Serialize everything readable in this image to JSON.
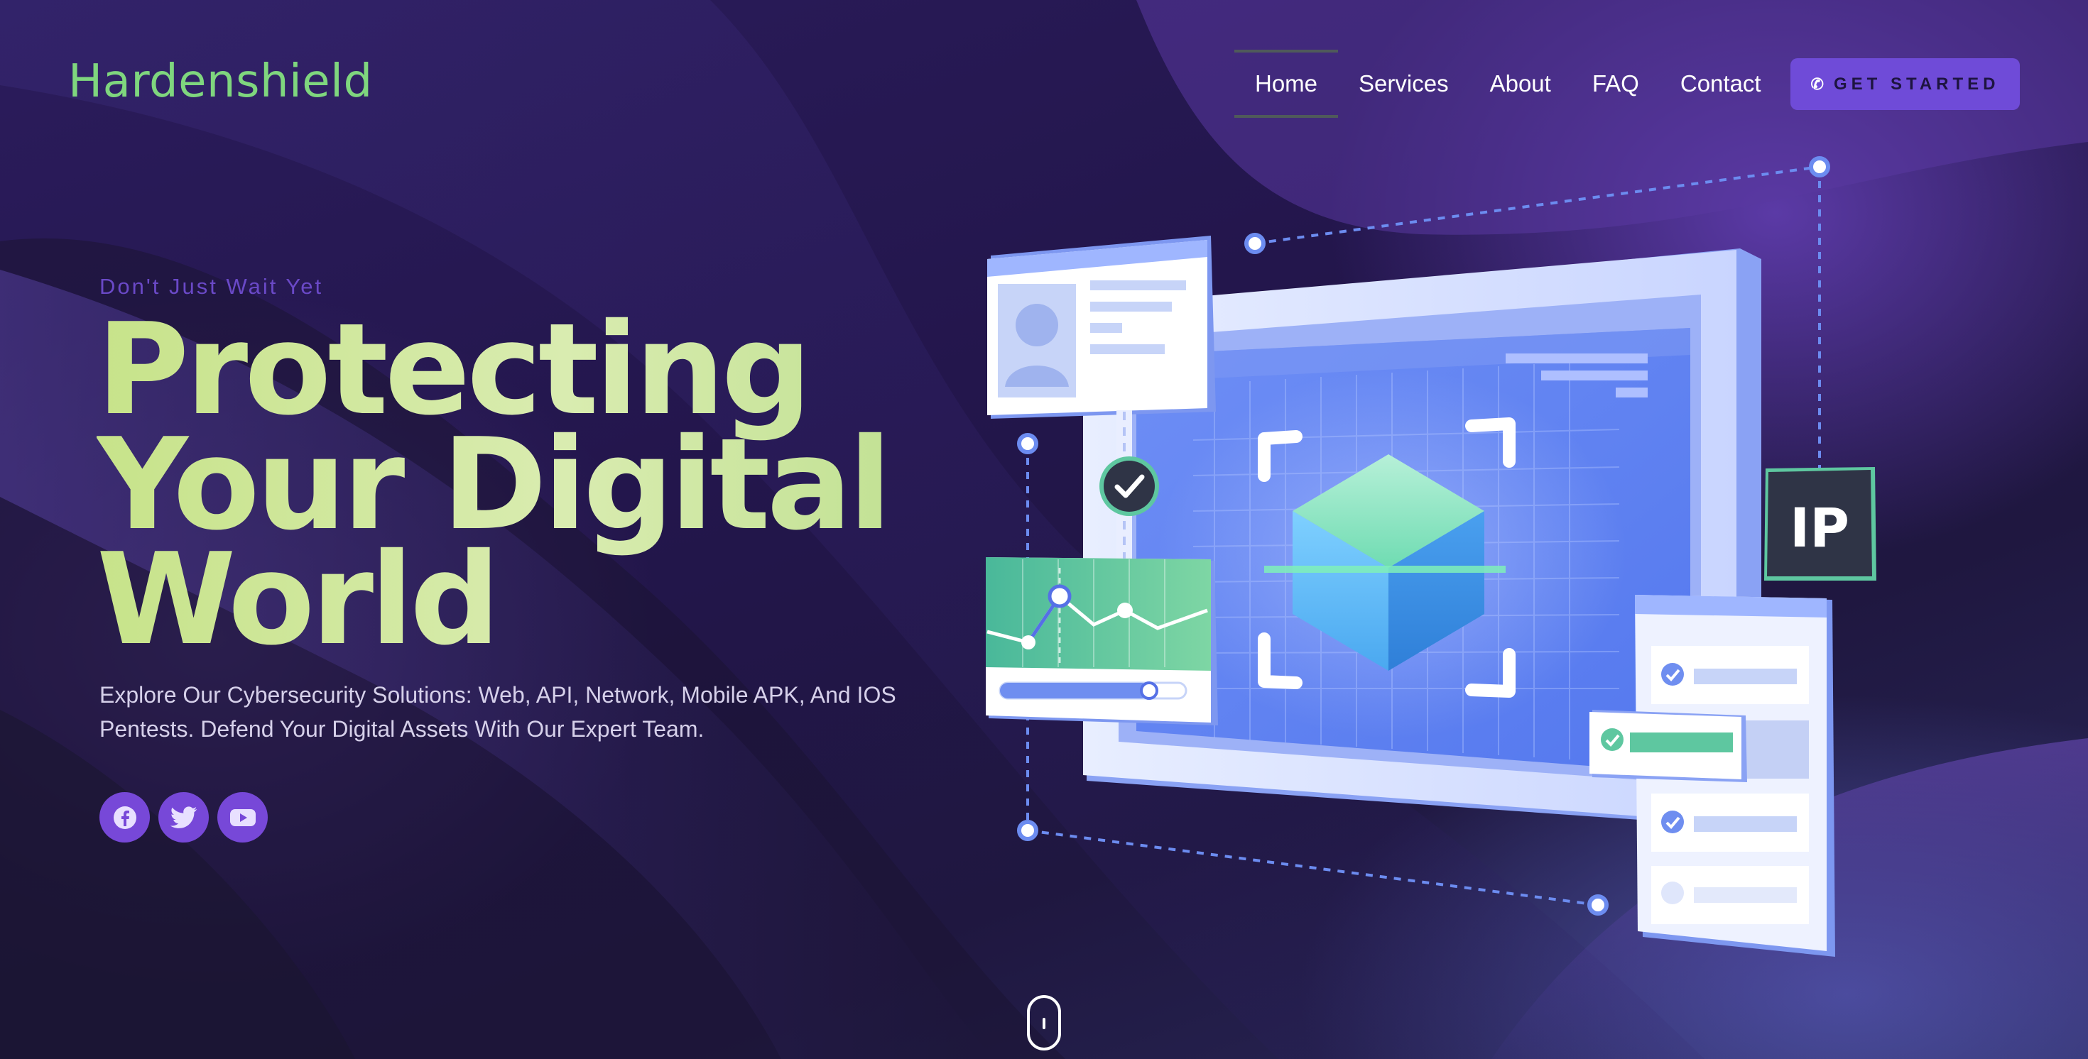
{
  "brand": {
    "name": "Hardenshield"
  },
  "nav": {
    "items": [
      {
        "label": "Home",
        "active": true
      },
      {
        "label": "Services",
        "active": false
      },
      {
        "label": "About",
        "active": false
      },
      {
        "label": "FAQ",
        "active": false
      },
      {
        "label": "Contact",
        "active": false
      }
    ],
    "cta_label": "GET STARTED",
    "cta_icon": "phone-icon"
  },
  "hero": {
    "kicker": "Don't Just Wait Yet",
    "headline": [
      "Protecting",
      "Your Digital",
      "World"
    ],
    "description": "Explore Our Cybersecurity Solutions: Web, API, Network, Mobile APK, And IOS Pentests. Defend Your Digital Assets With Our Expert Team."
  },
  "socials": [
    {
      "name": "facebook-icon"
    },
    {
      "name": "twitter-icon"
    },
    {
      "name": "youtube-icon"
    }
  ],
  "illustration": {
    "badge_text": "IP"
  },
  "colors": {
    "brand_green": "#7fd67e",
    "accent_purple": "#6f4bd8",
    "headline_green": "#d9ecb0",
    "kicker_purple": "#6a49c7"
  }
}
